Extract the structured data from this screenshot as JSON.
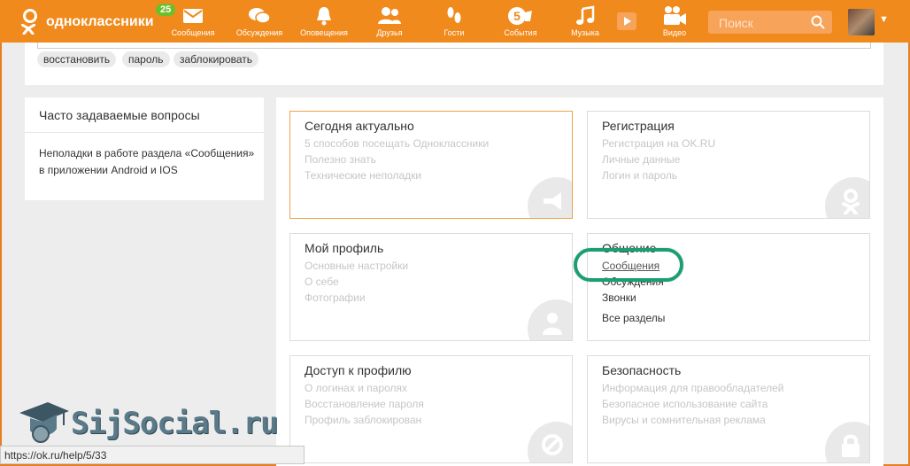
{
  "header": {
    "logo_text": "одноклассники",
    "notifications_badge": "25",
    "nav": [
      {
        "label": "Сообщения",
        "icon": "envelope-icon"
      },
      {
        "label": "Обсуждения",
        "icon": "chat-bubbles-icon"
      },
      {
        "label": "Оповещения",
        "icon": "bell-icon"
      },
      {
        "label": "Друзья",
        "icon": "friends-icon"
      },
      {
        "label": "Гости",
        "icon": "footprints-icon"
      },
      {
        "label": "События",
        "icon": "events-icon"
      },
      {
        "label": "Музыка",
        "icon": "music-note-icon"
      },
      {
        "label": "",
        "icon": "video-play-icon"
      },
      {
        "label": "Видео",
        "icon": "video-camera-icon"
      }
    ],
    "search_placeholder": "Поиск",
    "colors": {
      "bar": "#f18a1c",
      "search": "#f7a35a",
      "badge": "#6cbf2a"
    }
  },
  "top_panel": {
    "tags": [
      "восстановить",
      "пароль",
      "заблокировать"
    ]
  },
  "faq": {
    "title": "Часто задаваемые вопросы",
    "text": "Неполадки в работе раздела «Сообщения» в приложении Android и IOS"
  },
  "cards": [
    {
      "title": "Сегодня актуально",
      "links": [
        "5 способов посещать Одноклассники",
        "Полезно знать",
        "Технические неполадки"
      ],
      "icon": "megaphone-icon"
    },
    {
      "title": "Регистрация",
      "links": [
        "Регистрация на OK.RU",
        "Личные данные",
        "Логин и пароль"
      ],
      "icon": "ok-logo-icon"
    },
    {
      "title": "Мой профиль",
      "links": [
        "Основные настройки",
        "О себе",
        "Фотографии"
      ],
      "icon": "user-icon"
    },
    {
      "title": "Общение",
      "links": [
        "Сообщения",
        "Обсуждения",
        "Звонки",
        "Все разделы"
      ],
      "icon": "chat-icon"
    },
    {
      "title": "Доступ к профилю",
      "links": [
        "О логинах и паролях",
        "Восстановление пароля",
        "Профиль заблокирован"
      ],
      "icon": "blocked-icon"
    },
    {
      "title": "Безопасность",
      "links": [
        "Информация для правообладателей",
        "Безопасное использование сайта",
        "Вирусы и сомнительная реклама"
      ],
      "icon": "lock-icon"
    }
  ],
  "watermark": "SijSocial.ru",
  "status_url": "https://ok.ru/help/5/33",
  "highlight_color": "#1c9e74"
}
